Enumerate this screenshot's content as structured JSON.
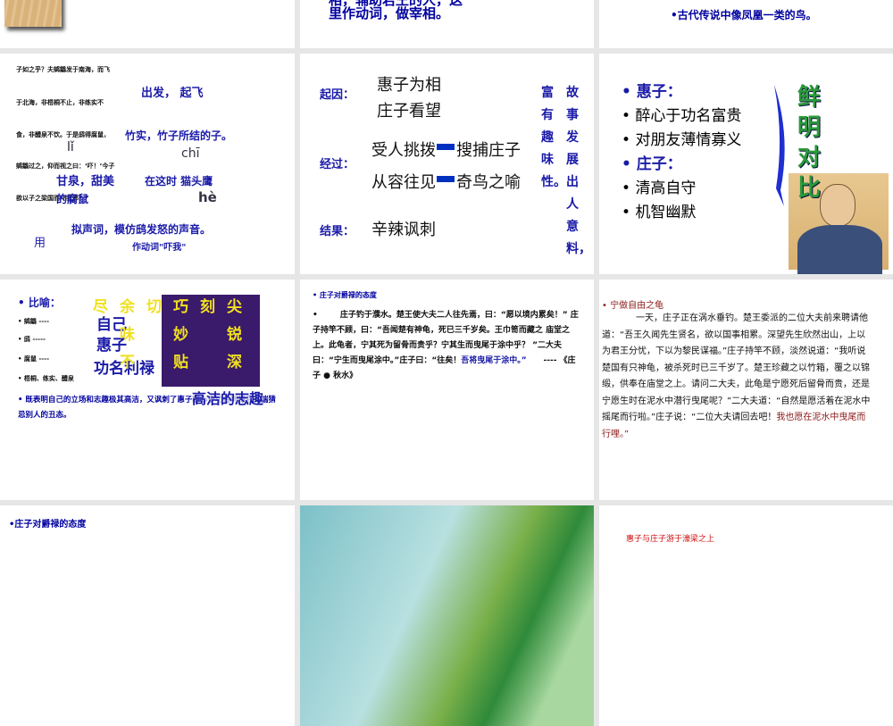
{
  "slides": {
    "s1": {},
    "s2": {
      "line1": "相，辅助君王的人，这",
      "line2": "里作动词，做宰相。"
    },
    "s3": {
      "note": "•古代传说中像凤凰一类的鸟。"
    },
    "s4": {
      "lines": [
        "子如之乎？夫鹓鶵发于南海，而飞",
        "于北海，非梧桐不止，非练实不",
        "食，非醴泉不饮。于是鸱得腐鼠，",
        "鹓鶵过之，仰而视之曰：‘吓！’今子",
        "欲以子之梁国而吓我邪？”"
      ],
      "notes": [
        "出发， 起飞",
        "竹实，竹子所结的子。",
        "lǐ",
        "chī",
        "甘泉，甜美",
        "在这时 猫头鹰",
        "hè",
        "拟声词，模仿鸱发怒的声音。",
        "作动词\"吓我\"",
        "用",
        "的腐鼠"
      ]
    },
    "s5": {
      "labels": [
        "起因：",
        "经过：",
        "结果："
      ],
      "items": [
        "惠子为相",
        "庄子看望",
        "受人挑拨",
        "搜捕庄子",
        "从容往见",
        "奇鸟之喻",
        "辛辣讽刺"
      ],
      "col1": "富有趣味性。",
      "col2": "故事发展出人意料，"
    },
    "s6": {
      "items": [
        {
          "t": "惠子：",
          "h": true
        },
        {
          "t": "醉心于功名富贵"
        },
        {
          "t": "对朋友薄情寡义"
        },
        {
          "t": "庄子：",
          "h": true
        },
        {
          "t": "清高自守"
        },
        {
          "t": "机智幽默"
        }
      ],
      "vertical": "鲜明对比"
    },
    "s7": {
      "title": "比喻：",
      "items": [
        "鹓鶵 ----",
        "鸱 -----",
        "腐鼠 ----",
        "梧桐、练实、醴泉"
      ],
      "overlay": [
        "尽",
        "余",
        "切",
        "巧",
        "刻",
        "尖",
        "味",
        "妙",
        "锐",
        "不",
        "贴",
        "深"
      ],
      "answers": [
        "自己",
        "惠子",
        "功名利禄",
        "高洁的志趣"
      ],
      "summary": "既表明自己的立场和志趣极其高洁，又讽刺了惠子醉心于功名利禄且无端猜忌别人的丑态。"
    },
    "s8": {
      "title": "庄子对爵禄的态度",
      "body": "庄子钓于濮水。楚王使大夫二人往先焉，曰：“愿以境内累矣！” 庄子持竿不顾，曰：“吾闻楚有神龟，死已三千岁矣。王巾笥而藏之 庙堂之上。此龟者，宁其死为留骨而贵乎？宁其生而曳尾于涂中乎？ ”二大夫曰：“宁生而曳尾涂中。”庄子曰：“往矣！",
      "highlight": "吾将曳尾于涂中。”",
      "source": "---- 《庄子 ● 秋水》"
    },
    "s9": {
      "title": "宁做自由之龟",
      "body": "一天，庄子正在涡水垂钓。楚王委派的二位大夫前来聘请他道：“吾王久闻先生贤名，欲以国事相累。深望先生欣然出山，上以为君王分忧，下以为黎民谋福。”庄子持竿不顾，淡然说道：“我听说楚国有只神龟，被杀死时已三千岁了。楚王珍藏之以竹箱，覆之以锦缎，供奉在庙堂之上。请问二大夫，此龟是宁愿死后留骨而贵，还是宁愿生时在泥水中潜行曳尾呢？”二大夫道：“自然是愿活着在泥水中摇尾而行啦。”庄子说：“二位大夫请回去吧！",
      "ending": "我也愿在泥水中曳尾而行哩。”"
    },
    "s10": {
      "title": "•庄子对爵禄的态度"
    },
    "s12": {
      "title": "惠子与庄子游于濠梁之上"
    }
  }
}
